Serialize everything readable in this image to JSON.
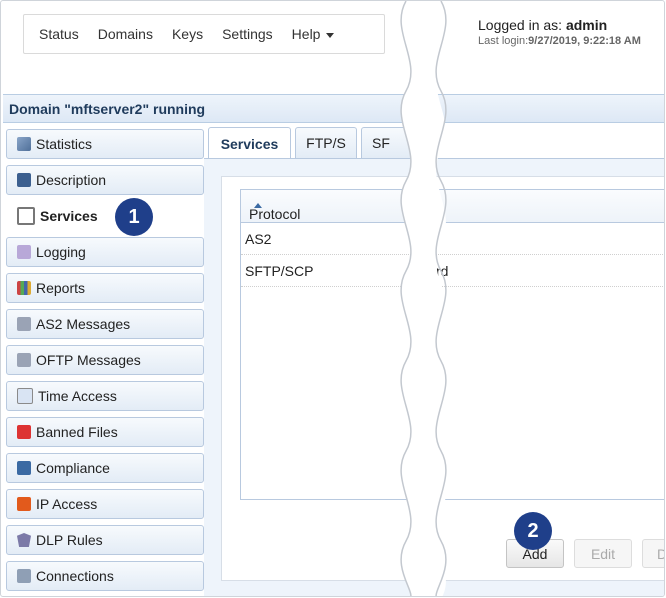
{
  "nav": {
    "items": [
      "Status",
      "Domains",
      "Keys",
      "Settings",
      "Help"
    ]
  },
  "login": {
    "prefix": "Logged in as:",
    "user": "admin",
    "last_label": "Last login:",
    "last_value": "9/27/2019, 9:22:18 AM"
  },
  "domain_status": "Domain \"mftserver2\" running",
  "sidebar": {
    "items": [
      {
        "label": "Statistics",
        "icon": "statistics-icon"
      },
      {
        "label": "Description",
        "icon": "description-icon"
      },
      {
        "label": "Services",
        "icon": "services-icon"
      },
      {
        "label": "Logging",
        "icon": "logging-icon"
      },
      {
        "label": "Reports",
        "icon": "reports-icon"
      },
      {
        "label": "AS2 Messages",
        "icon": "as2-messages-icon"
      },
      {
        "label": "OFTP Messages",
        "icon": "oftp-messages-icon"
      },
      {
        "label": "Time Access",
        "icon": "time-access-icon"
      },
      {
        "label": "Banned Files",
        "icon": "banned-files-icon"
      },
      {
        "label": "Compliance",
        "icon": "compliance-icon"
      },
      {
        "label": "IP Access",
        "icon": "ip-access-icon"
      },
      {
        "label": "DLP Rules",
        "icon": "dlp-rules-icon"
      },
      {
        "label": "Connections",
        "icon": "connections-icon"
      }
    ],
    "active_index": 2
  },
  "tabs": [
    {
      "label": "Services"
    },
    {
      "label": "FTP/S"
    },
    {
      "label": "SF"
    }
  ],
  "grid": {
    "header": "Protocol",
    "rows": [
      {
        "protocol": "AS2",
        "partial": ""
      },
      {
        "protocol": "SFTP/SCP",
        "partial": "rd"
      }
    ]
  },
  "buttons": {
    "add": "Add",
    "edit": "Edit",
    "partial": "D"
  },
  "badges": [
    "1",
    "2"
  ]
}
